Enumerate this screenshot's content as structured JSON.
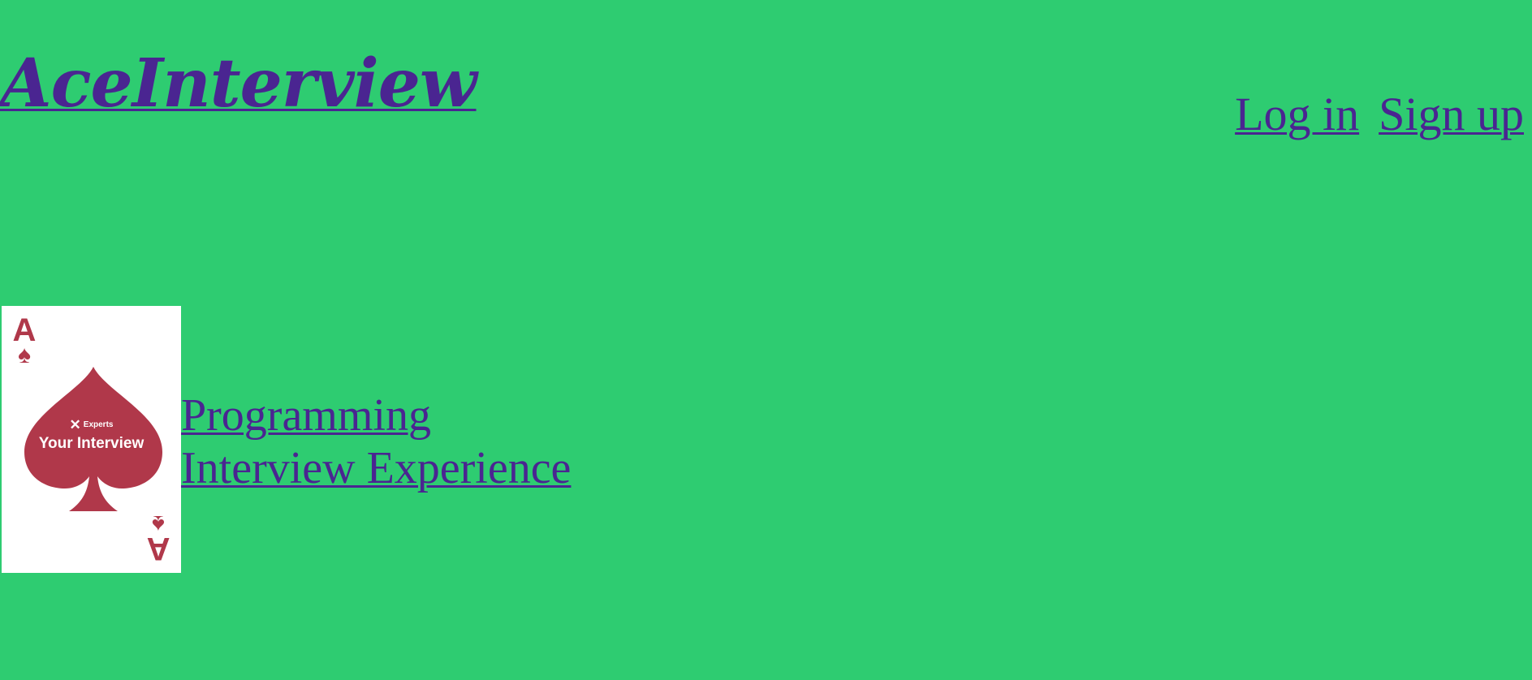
{
  "header": {
    "brand": "AceInterview",
    "login_label": "Log in",
    "signup_label": "Sign up"
  },
  "card": {
    "rank": "A",
    "suit_glyph": "♠",
    "brand_text": "Experts",
    "title": "Your Interview",
    "card_color": "#b0384a"
  },
  "topics": [
    {
      "label": "Programming"
    },
    {
      "label": "Interview Experience"
    }
  ],
  "colors": {
    "background": "#2ecc71",
    "link": "#4a2591"
  }
}
